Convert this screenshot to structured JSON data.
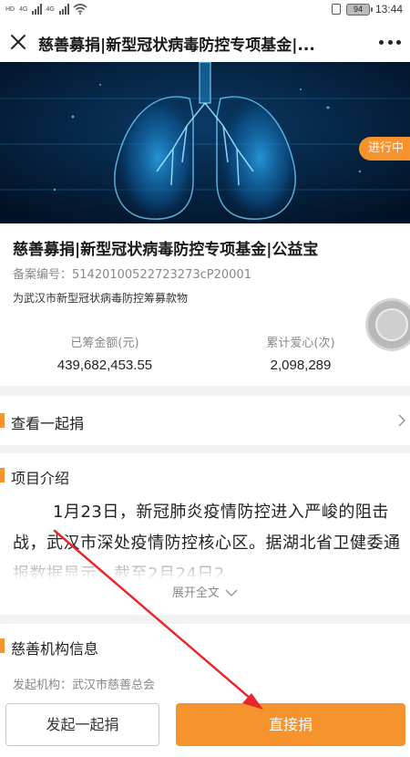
{
  "status_bar": {
    "carrier1": "HD",
    "net1": "4G",
    "net2": "4G",
    "battery": "94",
    "time": "13:44"
  },
  "title_bar": {
    "title": "慈善募捐|新型冠状病毒防控专项基金|...",
    "close_icon": "close-icon",
    "more_icon": "more-icon"
  },
  "hero": {
    "badge": "进行中",
    "colors": {
      "background": "#03172e",
      "glow": "#1e8fd6"
    }
  },
  "project": {
    "title": "慈善募捐|新型冠状病毒防控专项基金|公益宝",
    "reg_label": "备案编号：",
    "reg_number": "51420100522723273cP20001",
    "description": "为武汉市新型冠状病毒防控筹募款物",
    "raised_label": "已筹金额(元)",
    "raised_value": "439,682,453.55",
    "donors_label": "累计爱心(次)",
    "donors_value": "2,098,289"
  },
  "together_row": {
    "label": "查看一起捐",
    "icon": "chevron-right-icon"
  },
  "intro": {
    "heading": "项目介绍",
    "body": "1月23日，新冠肺炎疫情防控进入严峻的阻击战，武汉市深处疫情防控核心区。据湖北省卫健委通报数据显示，截至2月24日2",
    "expand_label": "展开全文",
    "expand_icon": "chevron-down-icon"
  },
  "org": {
    "heading": "慈善机构信息",
    "sponsor_label": "发起机构：",
    "sponsor_value": "武汉市慈善总会"
  },
  "bottom": {
    "left_button": "发起一起捐",
    "right_button": "直接捐"
  },
  "colors": {
    "accent": "#f7932d",
    "annotation": "#e8262b"
  }
}
